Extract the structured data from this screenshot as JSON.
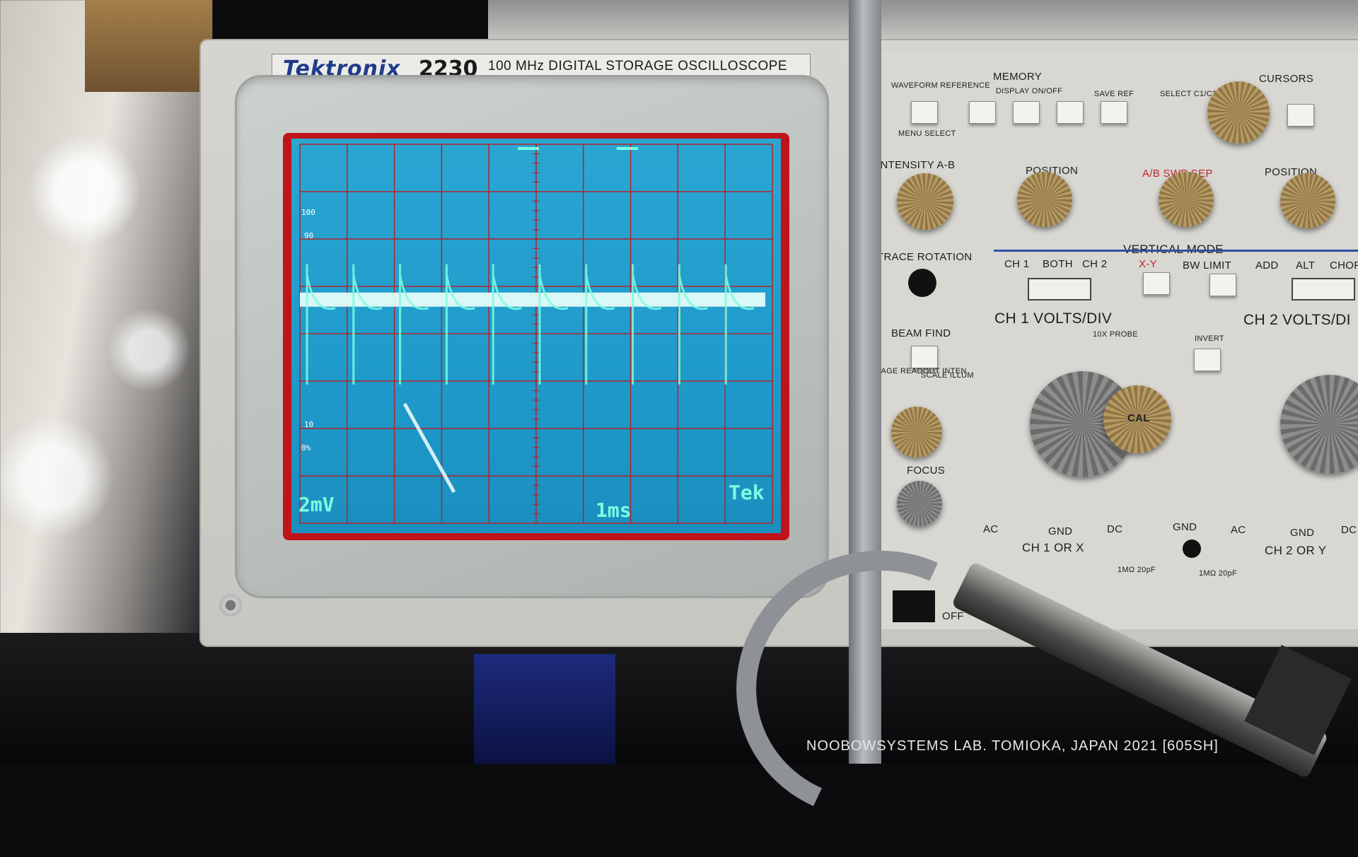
{
  "brand": {
    "logo": "Tektronix",
    "model": "2230",
    "description": "100 MHz DIGITAL STORAGE OSCILLOSCOPE"
  },
  "screen": {
    "ch1_volts": "2mV",
    "timebase": "1ms",
    "vendor_mark": "Tek",
    "grat_100": "100",
    "grat_90": "90",
    "grat_10": "10",
    "grat_0": "0%"
  },
  "panel": {
    "waveform_reference": "WAVEFORM REFERENCE",
    "memory": "MEMORY",
    "display_on_off": "DISPLAY ON/OFF",
    "save_ref": "SAVE REF",
    "select_c1c2": "SELECT C1/C2",
    "menu_select": "MENU SELECT",
    "cursors": "CURSORS",
    "intensity": "INTENSITY A-B",
    "position_left": "POSITION",
    "ab_swp_sep": "A/B SWP SEP",
    "position_right": "POSITION",
    "trace_rotation": "TRACE ROTATION",
    "vertical_mode": "VERTICAL MODE",
    "ch1": "CH 1",
    "both": "BOTH",
    "ch2": "CH 2",
    "xy": "X-Y",
    "bw_limit": "BW LIMIT",
    "add": "ADD",
    "alt": "ALT",
    "chop": "CHOP",
    "ch1_volts_div": "CH 1 VOLTS/DIV",
    "ch2_volts_div": "CH 2 VOLTS/DI",
    "invert": "INVERT",
    "probe_10x": "10X PROBE",
    "beam_find": "BEAM FIND",
    "storage_readout": "STORAGE READOUT INTEN",
    "scale_illum": "SCALE ILLUM",
    "focus": "FOCUS",
    "cal": "CAL",
    "ac": "AC",
    "gnd": "GND",
    "dc": "DC",
    "ch1_or_x": "CH 1 OR X",
    "ch2_or_y": "CH 2 OR Y",
    "impedance": "1MΩ 20pF",
    "off": "OFF"
  },
  "caption": "NOOBOWSYSTEMS LAB. TOMIOKA, JAPAN 2021 [605SH]",
  "chart_data": {
    "type": "line",
    "pulse_count": 10,
    "xlabel": "",
    "ylabel": ""
  },
  "colors": {
    "screen_bg": "#1e9bcb",
    "graticule": "#b3232b",
    "trace": "#eafff8",
    "readout": "#7dfde0"
  }
}
